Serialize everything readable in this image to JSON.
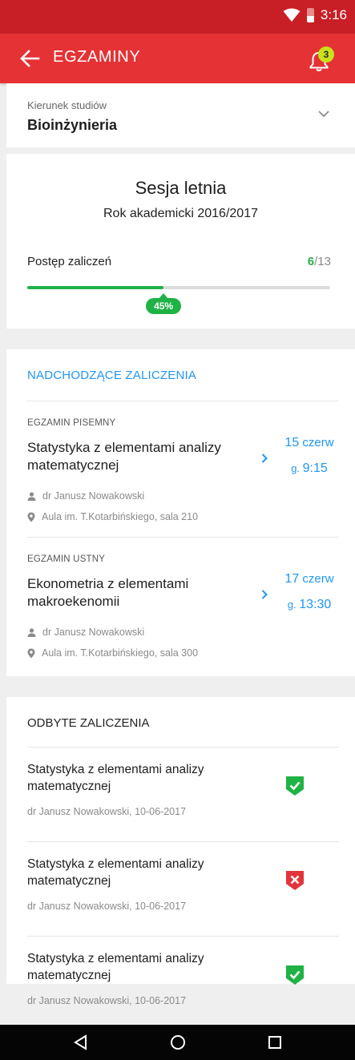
{
  "status_bar": {
    "time": "3:16",
    "wifi_icon": "wifi-icon",
    "battery_icon": "battery-icon"
  },
  "app_bar": {
    "back_icon": "arrow-left-icon",
    "title": "EGZAMINY",
    "notification_icon": "bell-icon",
    "notification_count": "3"
  },
  "field": {
    "label": "Kierunek studiów",
    "value": "Bioinżynieria",
    "dropdown_icon": "chevron-down-icon"
  },
  "session": {
    "title": "Sesja letnia",
    "academic_year": "Rok akademicki 2016/2017",
    "progress_label": "Postęp zaliczeń",
    "completed": "6",
    "total": "/13",
    "percent_label": "45%",
    "progress_fraction": 0.45
  },
  "upcoming": {
    "header": "NADCHODZĄCE ZALICZENIA",
    "exams": [
      {
        "type": "EGZAMIN PISEMNY",
        "subject": "Statystyka z elementami analizy matematycznej",
        "day": "15",
        "month": " czerw",
        "time_prefix": "g. ",
        "time": "9:15",
        "lecturer": "dr Janusz Nowakowski",
        "location": "Aula im. T.Kotarbińskiego, sala 210"
      },
      {
        "type": "EGZAMIN USTNY",
        "subject": "Ekonometria z elementami makroekenomii",
        "day": "17",
        "month": " czerw",
        "time_prefix": "g. ",
        "time": "13:30",
        "lecturer": "dr Janusz Nowakowski",
        "location": "Aula im. T.Kotarbińskiego, sala 300"
      }
    ]
  },
  "past": {
    "header": "ODBYTE ZALICZENIA",
    "items": [
      {
        "subject": "Statystyka z elementami analizy matematycznej",
        "meta": "dr Janusz Nowakowski, 10-06-2017",
        "status": "passed"
      },
      {
        "subject": "Statystyka z elementami analizy matematycznej",
        "meta": "dr Janusz Nowakowski, 10-06-2017",
        "status": "failed"
      },
      {
        "subject": "Statystyka z elementami analizy matematycznej",
        "meta": "dr Janusz Nowakowski, 10-06-2017",
        "status": "passed"
      }
    ]
  },
  "colors": {
    "primary_red": "#e53235",
    "status_red": "#c71f25",
    "accent_blue": "#2196f3",
    "pass_green": "#1fb245",
    "fail_red": "#e2353b",
    "badge_yellow": "#c9e21b"
  },
  "nav": {
    "back_icon": "nav-back-icon",
    "home_icon": "nav-home-icon",
    "recents_icon": "nav-recents-icon"
  }
}
